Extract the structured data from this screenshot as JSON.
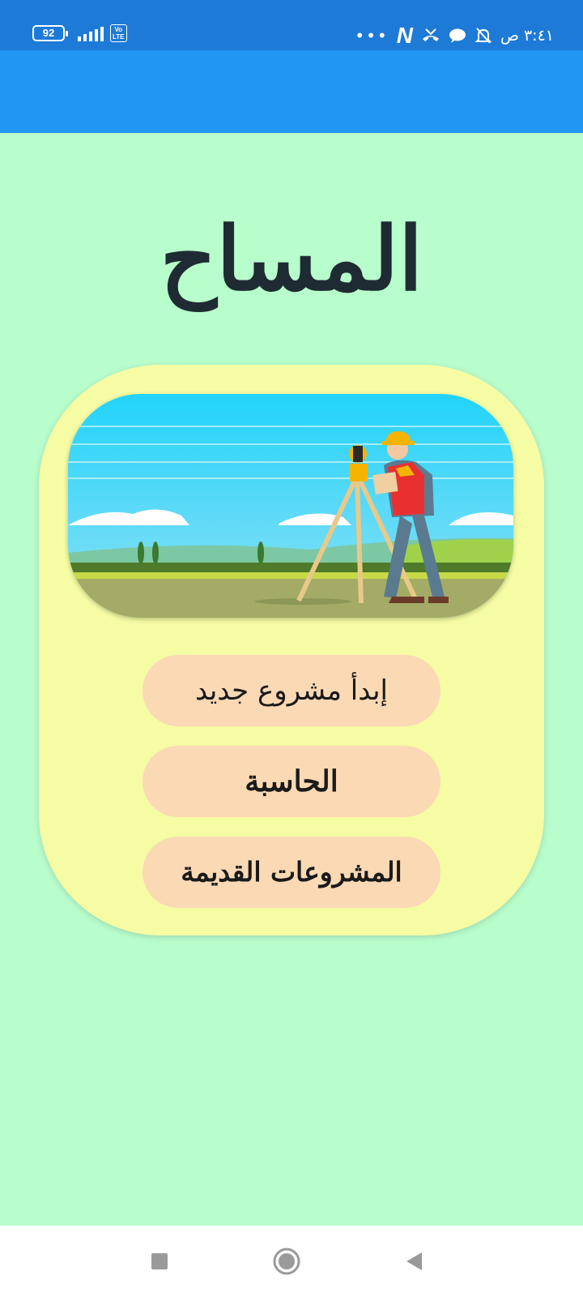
{
  "status_bar": {
    "time": "٣:٤١ ص",
    "battery": "92",
    "network": "VoLTE",
    "more_dots": "•••",
    "notification_app": "N"
  },
  "app_title": "المساح",
  "buttons": {
    "new_project": "إبدأ مشروع جديد",
    "calculator": "الحاسبة",
    "old_projects": "المشروعات القديمة"
  },
  "colors": {
    "status_bar": "#1e7ad7",
    "app_bar": "#2196f3",
    "background": "#b8fdcc",
    "card": "#f5fca4",
    "button": "#fad9b4"
  },
  "icons": {
    "nav_recents": "square-icon",
    "nav_home": "circle-icon",
    "nav_back": "triangle-back-icon"
  }
}
